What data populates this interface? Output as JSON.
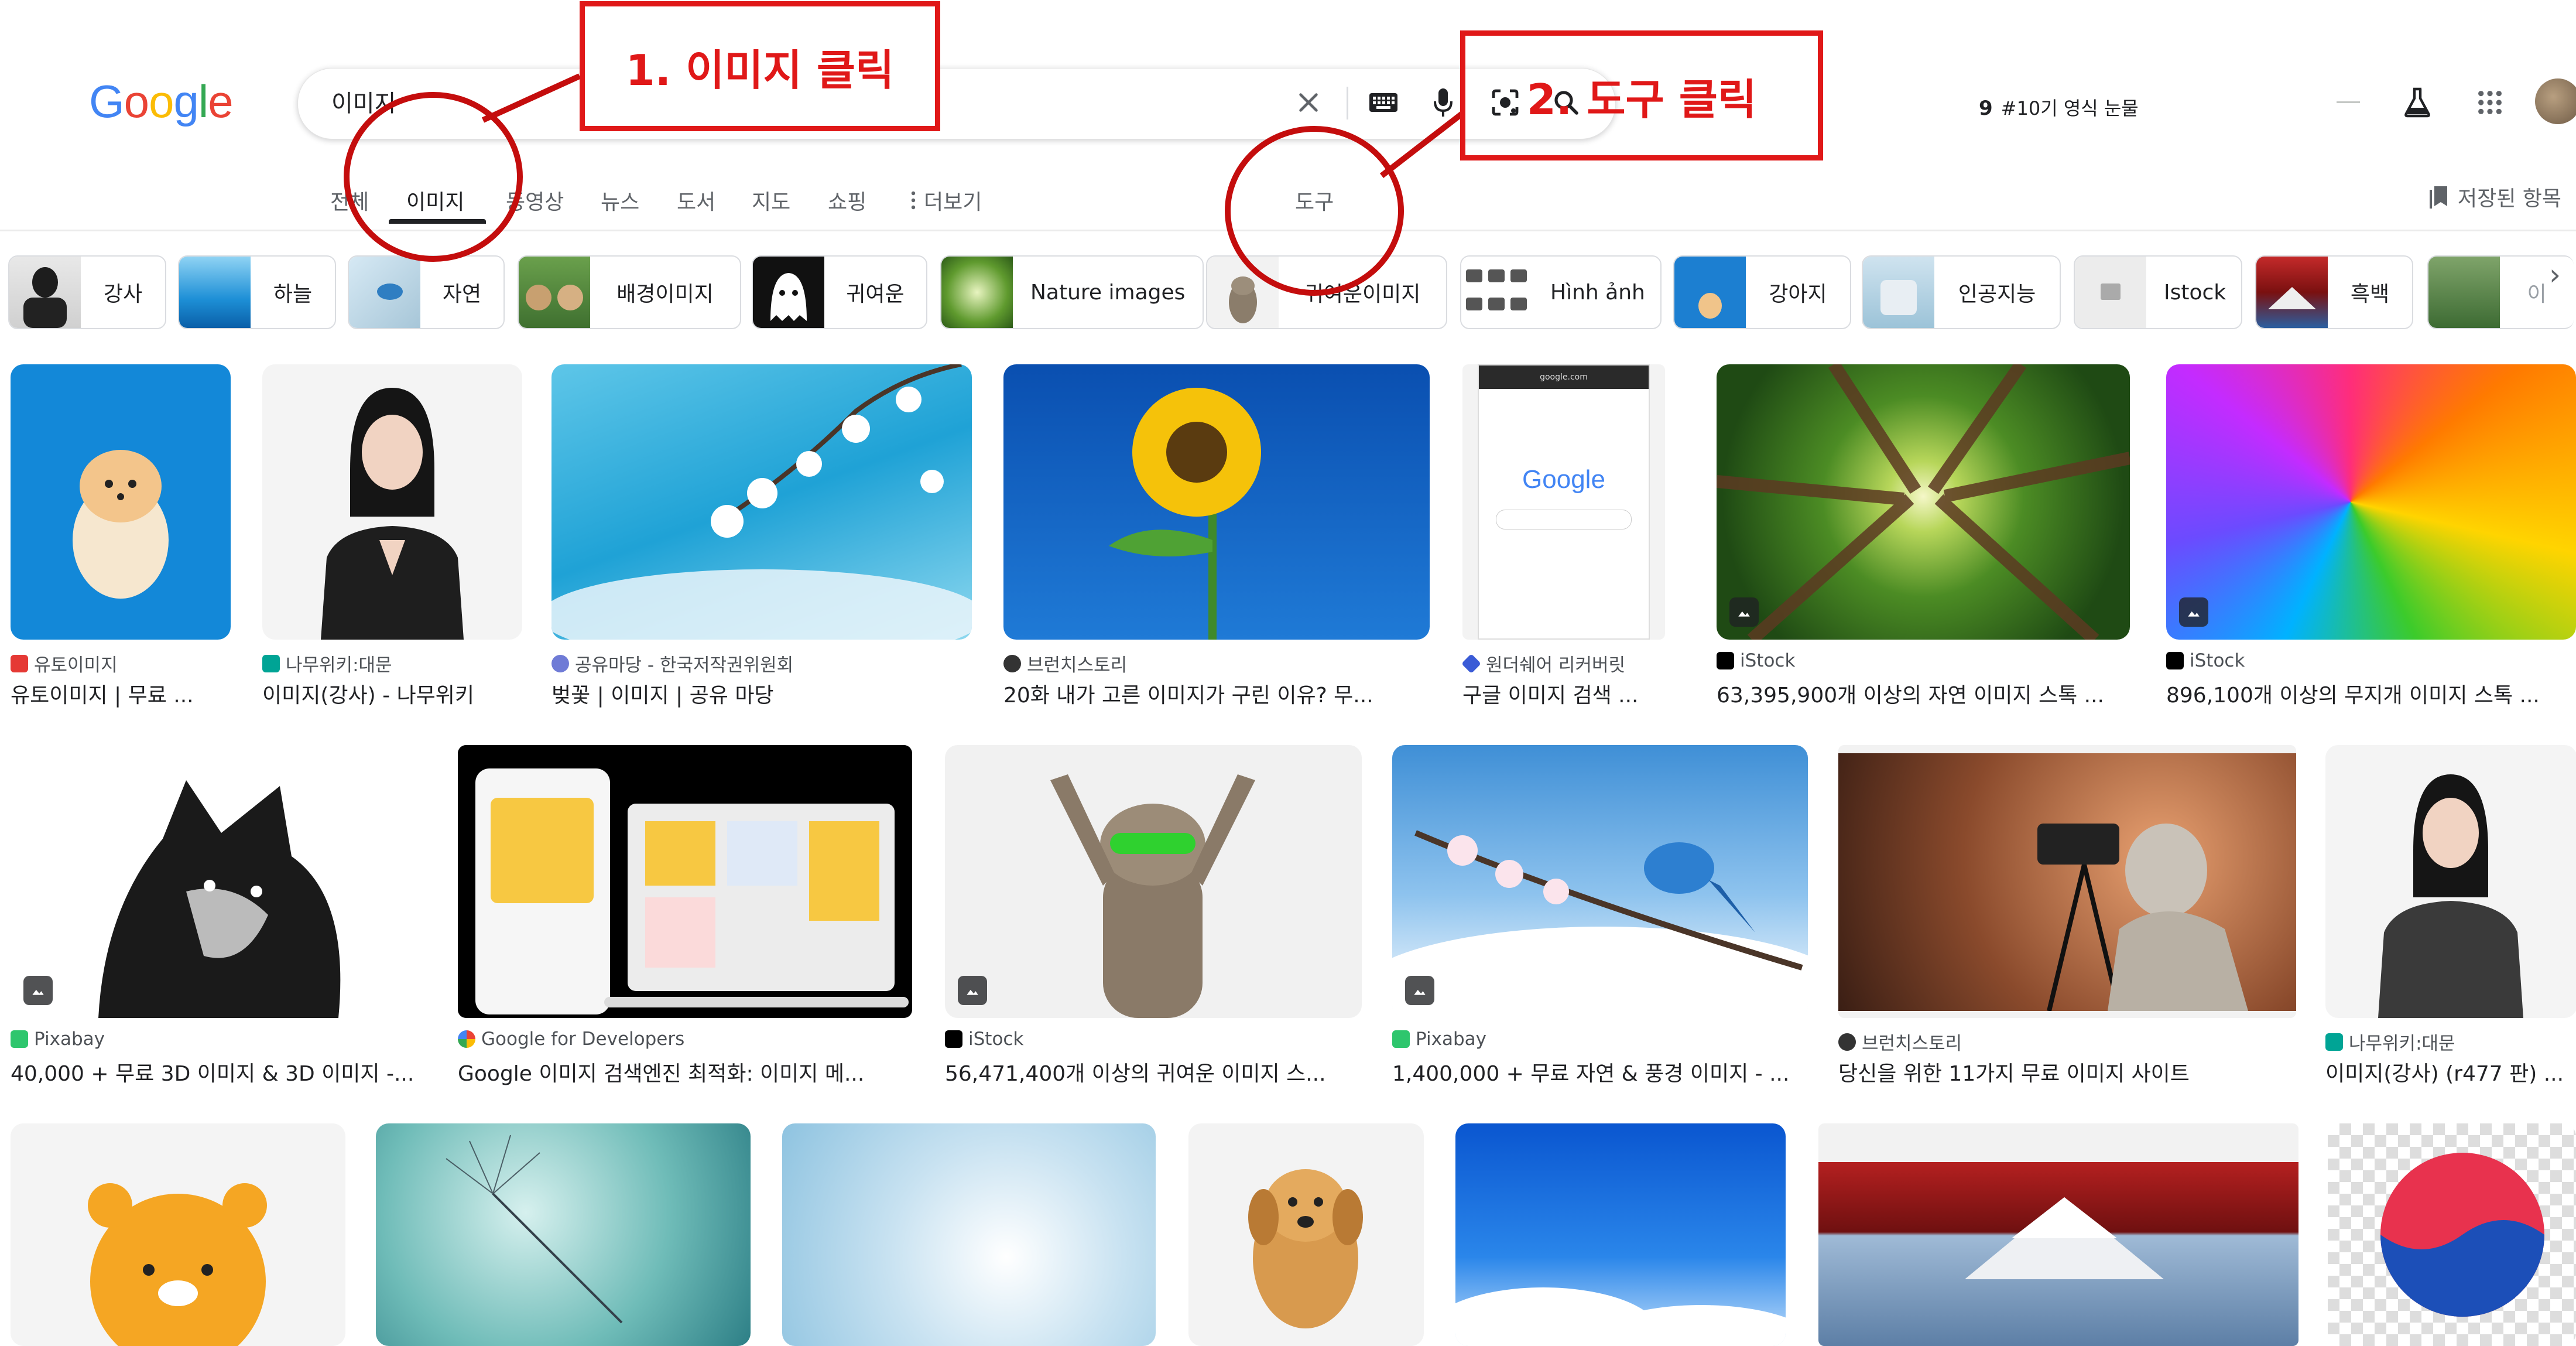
{
  "header": {
    "logo": "Google",
    "search_value": "이미지",
    "promo_number": "9",
    "promo_text": "#10기 영식 눈물",
    "icons": [
      "close-icon",
      "keyboard-icon",
      "mic-icon",
      "lens-icon",
      "search-icon",
      "labs-icon",
      "apps-grid-icon",
      "avatar"
    ]
  },
  "tabs": {
    "all": "전체",
    "images": "이미지",
    "videos": "동영상",
    "news": "뉴스",
    "books": "도서",
    "maps": "지도",
    "shopping": "쇼핑",
    "more": "더보기",
    "tools": "도구",
    "saved": "저장된 항목"
  },
  "chips": [
    {
      "label": "강사"
    },
    {
      "label": "하늘"
    },
    {
      "label": "자연"
    },
    {
      "label": "배경이미지"
    },
    {
      "label": "귀여운"
    },
    {
      "label": "Nature images"
    },
    {
      "label": "귀여운이미지"
    },
    {
      "label": "Hình ảnh"
    },
    {
      "label": "강아지"
    },
    {
      "label": "인공지능"
    },
    {
      "label": "Istock"
    },
    {
      "label": "흑백"
    },
    {
      "label": "이"
    }
  ],
  "results": {
    "row1": [
      {
        "source": "유토이미지",
        "title": "유토이미지 | 무료 ..."
      },
      {
        "source": "나무위키:대문",
        "title": "이미지(강사) - 나무위키"
      },
      {
        "source": "공유마당 - 한국저작권위원회",
        "title": "벚꽃 | 이미지 | 공유 마당"
      },
      {
        "source": "브런치스토리",
        "title": "20화 내가 고른 이미지가 구린 이유? 무..."
      },
      {
        "source": "원더쉐어 리커버릿",
        "title": "구글 이미지 검색 ..."
      },
      {
        "source": "iStock",
        "title": "63,395,900개 이상의 자연 이미지 스톡 ..."
      },
      {
        "source": "iStock",
        "title": "896,100개 이상의 무지개 이미지 스톡 ..."
      }
    ],
    "row2": [
      {
        "source": "Pixabay",
        "title": "40,000 + 무료 3D 이미지 & 3D 이미지 -..."
      },
      {
        "source": "Google for Developers",
        "title": "Google 이미지 검색엔진 최적화: 이미지 메..."
      },
      {
        "source": "iStock",
        "title": "56,471,400개 이상의 귀여운 이미지 스..."
      },
      {
        "source": "Pixabay",
        "title": "1,400,000 + 무료 자연 & 풍경 이미지 - ..."
      },
      {
        "source": "브런치스토리",
        "title": "당신을 위한 11가지 무료 이미지 사이트"
      },
      {
        "source": "나무위키:대문",
        "title": "이미지(강사) (r477 판) ..."
      }
    ]
  },
  "thumbnail_text": {
    "phone_url": "google.com",
    "phone_logo": "Google"
  },
  "annotations": {
    "step1": "1. 이미지 클릭",
    "step2": "2. 도구 클릭",
    "color": "#e01818"
  }
}
